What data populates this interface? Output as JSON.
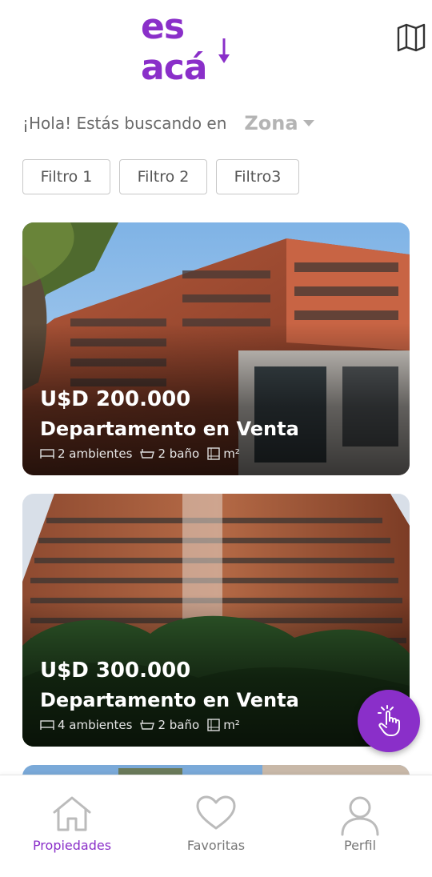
{
  "header": {
    "logo_text": "es acá",
    "brand_color": "#8a2fc9",
    "map_icon": "map-icon"
  },
  "search": {
    "greeting": "¡Hola! Estás buscando en",
    "zone_value": "Zona"
  },
  "filters": [
    "Filtro 1",
    "Filtro 2",
    "Filtro3"
  ],
  "listings": [
    {
      "price": "U$D 200.000",
      "type": "Departamento en Venta",
      "rooms": "2 ambientes",
      "baths": "2 baño",
      "area": "m²"
    },
    {
      "price": "U$D 300.000",
      "type": "Departamento en Venta",
      "rooms": "4 ambientes",
      "baths": "2 baño",
      "area": "m²"
    }
  ],
  "fab": {
    "icon": "tap-hand-icon"
  },
  "bottom_nav": [
    {
      "label": "Propiedades",
      "icon": "home-icon",
      "active": true
    },
    {
      "label": "Favoritas",
      "icon": "heart-icon",
      "active": false
    },
    {
      "label": "Perfil",
      "icon": "user-icon",
      "active": false
    }
  ],
  "colors": {
    "accent": "#8a2fc9",
    "muted": "#b4b4b4"
  }
}
